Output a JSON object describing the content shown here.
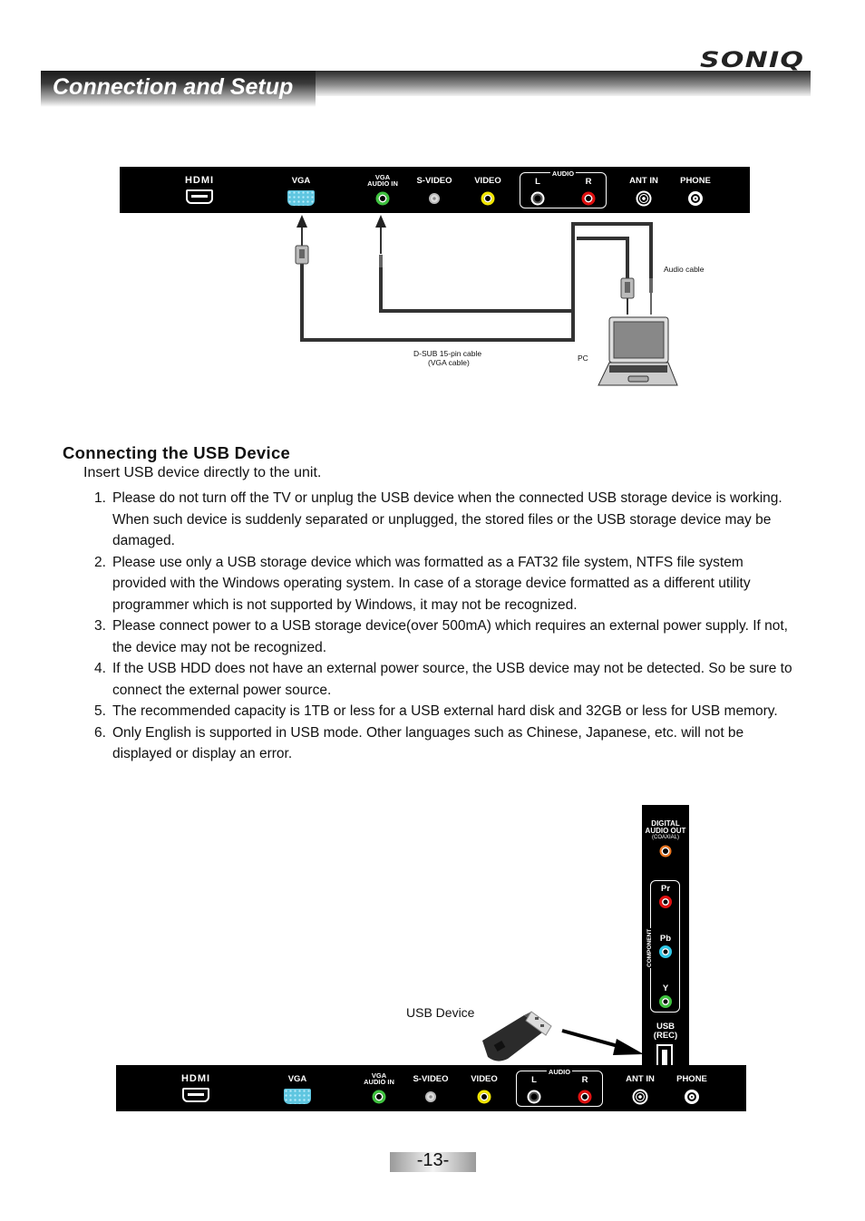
{
  "header": {
    "brand": "SONIQ",
    "section_title": "Connection and Setup"
  },
  "rear_panel": {
    "ports": [
      {
        "label": "HDMI",
        "type": "hdmi",
        "color": "#ffffff"
      },
      {
        "label": "VGA",
        "type": "vga",
        "color": "#5fc6e0"
      },
      {
        "label_line1": "VGA",
        "label_line2": "AUDIO IN",
        "type": "jack",
        "color": "#3fc23f"
      },
      {
        "label": "S-VIDEO",
        "type": "svideo",
        "color": "#bbbbbb"
      },
      {
        "label": "VIDEO",
        "type": "jack",
        "color": "#f2e600"
      },
      {
        "group": "AUDIO",
        "left_label": "L",
        "right_label": "R",
        "left_color": "#ffffff",
        "right_color": "#e01010"
      },
      {
        "label": "ANT IN",
        "type": "coax",
        "color": "#ffffff"
      },
      {
        "label": "PHONE",
        "type": "jack",
        "color": "#ffffff"
      }
    ]
  },
  "pc_diagram": {
    "vga_cable_label_line1": "D-SUB 15-pin cable",
    "vga_cable_label_line2": "(VGA cable)",
    "audio_cable_label": "Audio cable",
    "pc_label": "PC"
  },
  "usb_section": {
    "title": "Connecting the USB Device",
    "intro": "Insert USB device directly to the unit.",
    "items": [
      {
        "num": "1.",
        "text": "Please do not turn off the TV or unplug the USB device when the connected USB storage device is working. When such device is suddenly separated or unplugged, the stored files or the USB storage device may be damaged."
      },
      {
        "num": "2.",
        "text": "Please use only a USB storage device which was formatted as a FAT32 file system, NTFS file system provided with the Windows operating system. In case of a storage device formatted as a different utility programmer which is not supported by Windows, it may not be recognized."
      },
      {
        "num": "3.",
        "text": "Please connect power to a USB storage device(over 500mA) which requires an external power supply. If not, the device may not be recognized."
      },
      {
        "num": "4.",
        "text": "If the USB HDD does not have an external power source, the USB device may not be detected. So be sure to connect the external power source."
      },
      {
        "num": "5.",
        "text": "The recommended capacity is 1TB or less for a USB external hard disk and 32GB or less for USB memory."
      },
      {
        "num": "6.",
        "text": "Only English is supported in USB mode. Other languages such as Chinese, Japanese, etc. will not be displayed or display an error."
      }
    ]
  },
  "side_panel": {
    "digital_line1": "DIGITAL",
    "digital_line2": "AUDIO OUT",
    "digital_line3": "(COAXIAL)",
    "digital_color": "#f07820",
    "component_label": "COMPONENT",
    "pr_label": "Pr",
    "pr_color": "#e01010",
    "pb_label": "Pb",
    "pb_color": "#30c8e8",
    "y_label": "Y",
    "y_color": "#3fc23f",
    "usb_line1": "USB",
    "usb_line2": "(REC)"
  },
  "usb_device_label": "USB Device",
  "page_number": "-13-"
}
